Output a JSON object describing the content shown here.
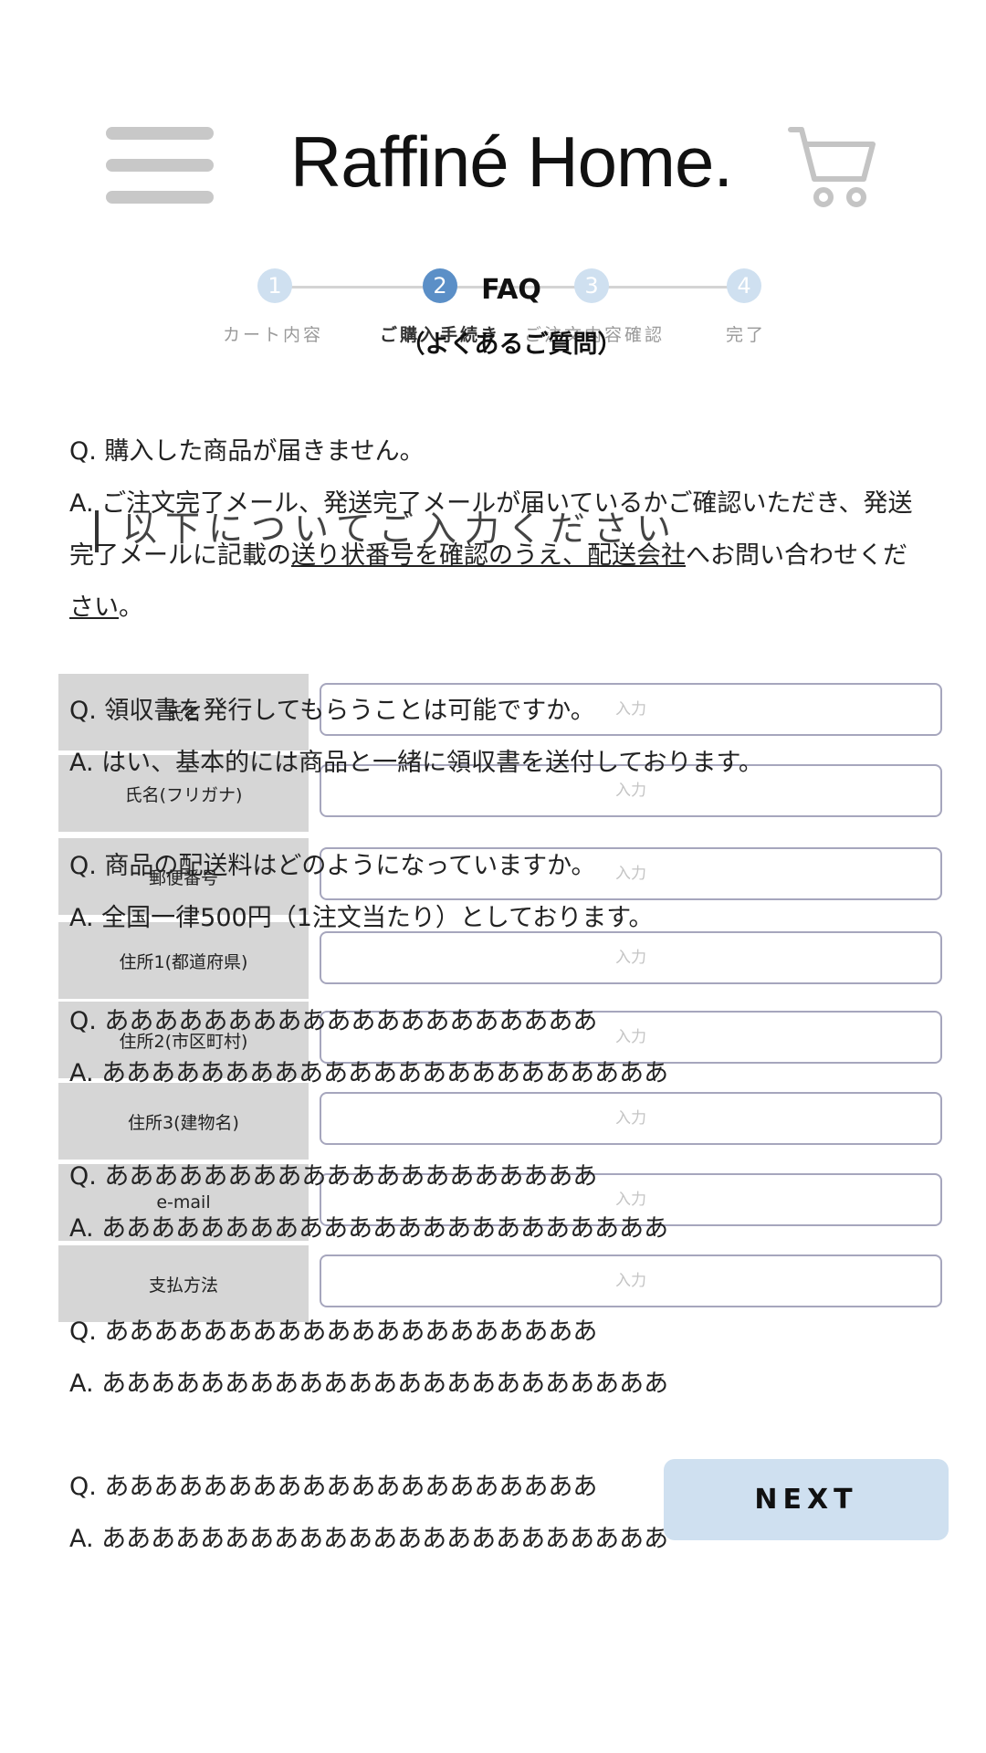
{
  "header": {
    "brand": "Raffiné Home.",
    "menu_icon": "hamburger-menu-icon",
    "cart_icon": "shopping-cart-icon"
  },
  "stepper": {
    "steps": [
      {
        "number": "1",
        "label": "カート内容"
      },
      {
        "number": "2",
        "label": "ご購入手続き"
      },
      {
        "number": "3",
        "label": "ご注文内容確認"
      },
      {
        "number": "4",
        "label": "完了"
      }
    ],
    "current_step": 2,
    "colors": {
      "active": "#5b8fc7",
      "inactive": "#cfe0f0"
    }
  },
  "faq_title": "FAQ",
  "faq_subtitle": "（よくあるご質問）",
  "form": {
    "heading": "以下についてご入力ください",
    "fields": [
      {
        "label": "氏名",
        "placeholder": "入力"
      },
      {
        "label": "氏名(フリガナ)",
        "placeholder": "入力"
      },
      {
        "label": "郵便番号",
        "placeholder": "入力"
      },
      {
        "label": "住所1(都道府県)",
        "placeholder": "入力"
      },
      {
        "label": "住所2(市区町村)",
        "placeholder": "入力"
      },
      {
        "label": "住所3(建物名)",
        "placeholder": "入力"
      },
      {
        "label": "e-mail",
        "placeholder": "入力"
      },
      {
        "label": "支払方法",
        "placeholder": "入力"
      }
    ]
  },
  "faq": [
    {
      "q": "Q. 購入した商品が届きません。",
      "a_line1": "A. ご注文完了メール、発送完了メールが届いているかご確認いただき、発送",
      "a_line2_plain": "完了メールに記載の",
      "a_line2_underlined": "送り状番号を確認のうえ、配送会社",
      "a_line2_tail": "へお問い合わせくだ",
      "a_line3_underlined": "さい",
      "a_line3_tail": "。"
    },
    {
      "q": "Q. 領収書を発行してもらうことは可能ですか。",
      "a": "A. はい、基本的には商品と一緒に領収書を送付しております。"
    },
    {
      "q": "Q. 商品の配送料はどのようになっていますか。",
      "a": "A. 全国一律500円（1注文当たり）としております。"
    },
    {
      "q": "Q. ああああああああああああああああああああ",
      "a": "A. あああああああああああああああああああああああ"
    },
    {
      "q": "Q. ああああああああああああああああああああ",
      "a": "A. あああああああああああああああああああああああ"
    },
    {
      "q": "Q. ああああああああああああああああああああ",
      "a": "A. あああああああああああああああああああああああ"
    },
    {
      "q": "Q. ああああああああああああああああああああ",
      "a": "A. あああああああああああああああああああああああ"
    }
  ],
  "next_button": "NEXT"
}
